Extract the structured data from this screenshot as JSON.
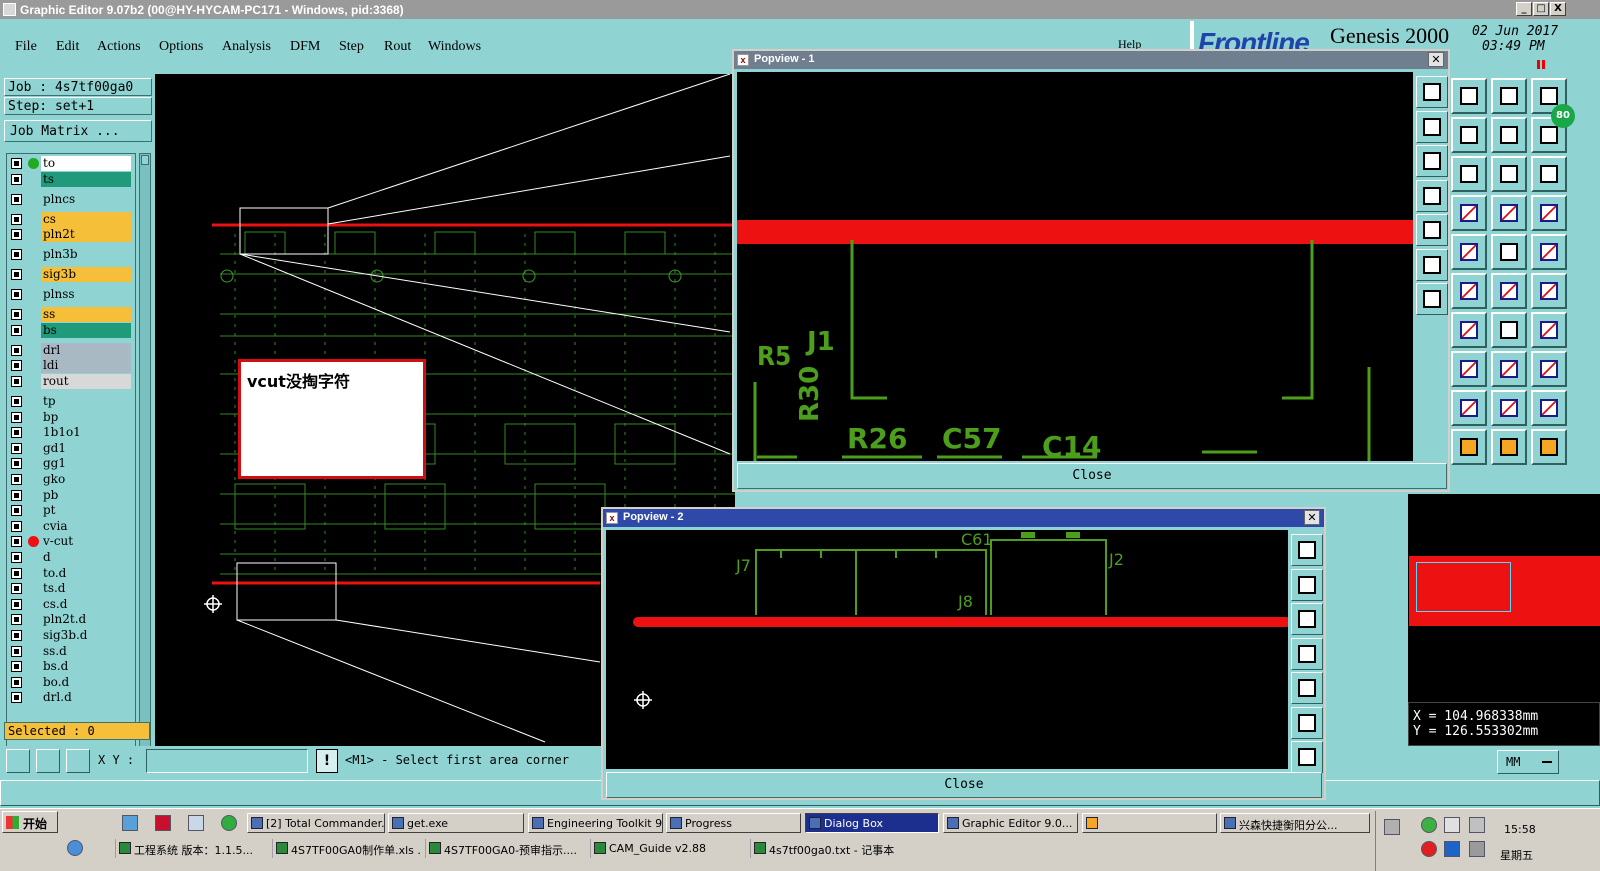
{
  "window": {
    "title": "Graphic Editor 9.07b2 (00@HY-HYCAM-PC171 - Windows, pid:3368)",
    "controls": [
      "_",
      "□",
      "X"
    ]
  },
  "menu": {
    "items": [
      "File",
      "Edit",
      "Actions",
      "Options",
      "Analysis",
      "DFM",
      "Step",
      "Rout",
      "Windows"
    ],
    "help_label": "Help"
  },
  "brand": {
    "logo": "Frontline",
    "product": "Genesis 2000",
    "date": "02 Jun 2017",
    "time": "03:49 PM"
  },
  "job": {
    "job_label": "Job : 4s7tf00ga0",
    "step_label": "Step: set+1",
    "matrix_button": "Job Matrix ..."
  },
  "layers": [
    {
      "name": "to",
      "color": "#ffffff",
      "dot": "#22aa22"
    },
    {
      "name": "ts",
      "color": "#1f9a7a",
      "dot": ""
    },
    {
      "name": "plncs",
      "color": "#8fd3d3",
      "dot": ""
    },
    {
      "name": "cs",
      "color": "#f5bf3a",
      "dot": ""
    },
    {
      "name": "pln2t",
      "color": "#f5bf3a",
      "dot": ""
    },
    {
      "name": "pln3b",
      "color": "#8fd3d3",
      "dot": ""
    },
    {
      "name": "sig3b",
      "color": "#f5bf3a",
      "dot": ""
    },
    {
      "name": "plnss",
      "color": "#8fd3d3",
      "dot": ""
    },
    {
      "name": "ss",
      "color": "#f5bf3a",
      "dot": ""
    },
    {
      "name": "bs",
      "color": "#1f9a7a",
      "dot": ""
    },
    {
      "name": "drl",
      "color": "#a9b9c4",
      "dot": ""
    },
    {
      "name": "ldi",
      "color": "#a9b9c4",
      "dot": ""
    },
    {
      "name": "rout",
      "color": "#d8d8d8",
      "dot": ""
    },
    {
      "name": "tp",
      "color": "#8fd3d3",
      "dot": ""
    },
    {
      "name": "bp",
      "color": "#8fd3d3",
      "dot": ""
    },
    {
      "name": "1b1o1",
      "color": "#8fd3d3",
      "dot": ""
    },
    {
      "name": "gd1",
      "color": "#8fd3d3",
      "dot": ""
    },
    {
      "name": "gg1",
      "color": "#8fd3d3",
      "dot": ""
    },
    {
      "name": "gko",
      "color": "#8fd3d3",
      "dot": ""
    },
    {
      "name": "pb",
      "color": "#8fd3d3",
      "dot": ""
    },
    {
      "name": "pt",
      "color": "#8fd3d3",
      "dot": ""
    },
    {
      "name": "cvia",
      "color": "#8fd3d3",
      "dot": ""
    },
    {
      "name": "v-cut",
      "color": "#8fd3d3",
      "dot": "#ee1111"
    },
    {
      "name": "d",
      "color": "#8fd3d3",
      "dot": ""
    },
    {
      "name": "to.d",
      "color": "#8fd3d3",
      "dot": ""
    },
    {
      "name": "ts.d",
      "color": "#8fd3d3",
      "dot": ""
    },
    {
      "name": "cs.d",
      "color": "#8fd3d3",
      "dot": ""
    },
    {
      "name": "pln2t.d",
      "color": "#8fd3d3",
      "dot": ""
    },
    {
      "name": "sig3b.d",
      "color": "#8fd3d3",
      "dot": ""
    },
    {
      "name": "ss.d",
      "color": "#8fd3d3",
      "dot": ""
    },
    {
      "name": "bs.d",
      "color": "#8fd3d3",
      "dot": ""
    },
    {
      "name": "bo.d",
      "color": "#8fd3d3",
      "dot": ""
    },
    {
      "name": "drl.d",
      "color": "#8fd3d3",
      "dot": ""
    }
  ],
  "selected": "Selected : 0",
  "note": "vcut没掏字符",
  "status": {
    "xy_label": "X Y :",
    "xy_value": "",
    "prompt": "<M1> - Select first area corner"
  },
  "coords": {
    "x": "X = 104.968338mm",
    "y": "Y = 126.553302mm",
    "units": "MM",
    "zoom_badge": "80"
  },
  "popview1": {
    "title": "Popview - 1",
    "close": "Close",
    "labels": [
      "R5",
      "J1",
      "R30",
      "R26",
      "C57",
      "C14"
    ]
  },
  "popview2": {
    "title": "Popview - 2",
    "close": "Close",
    "labels": [
      "C61",
      "J7",
      "J2",
      "J8"
    ]
  },
  "taskbar": {
    "start": "开始",
    "row1": [
      "[2] Total Commander...",
      "get.exe",
      "Engineering Toolkit 9...",
      "Progress",
      "Dialog Box",
      "Graphic Editor 9.0...",
      "",
      "兴森快捷衡阳分公..."
    ],
    "row2": [
      "工程系统  版本：1.1.5...",
      "4S7TF00GA0制作单.xls ...",
      "4S7TF00GA0-预审指示....",
      "CAM_Guide v2.88",
      "4s7tf00ga0.txt - 记事本"
    ],
    "clock": "15:58",
    "weekday": "星期五"
  }
}
